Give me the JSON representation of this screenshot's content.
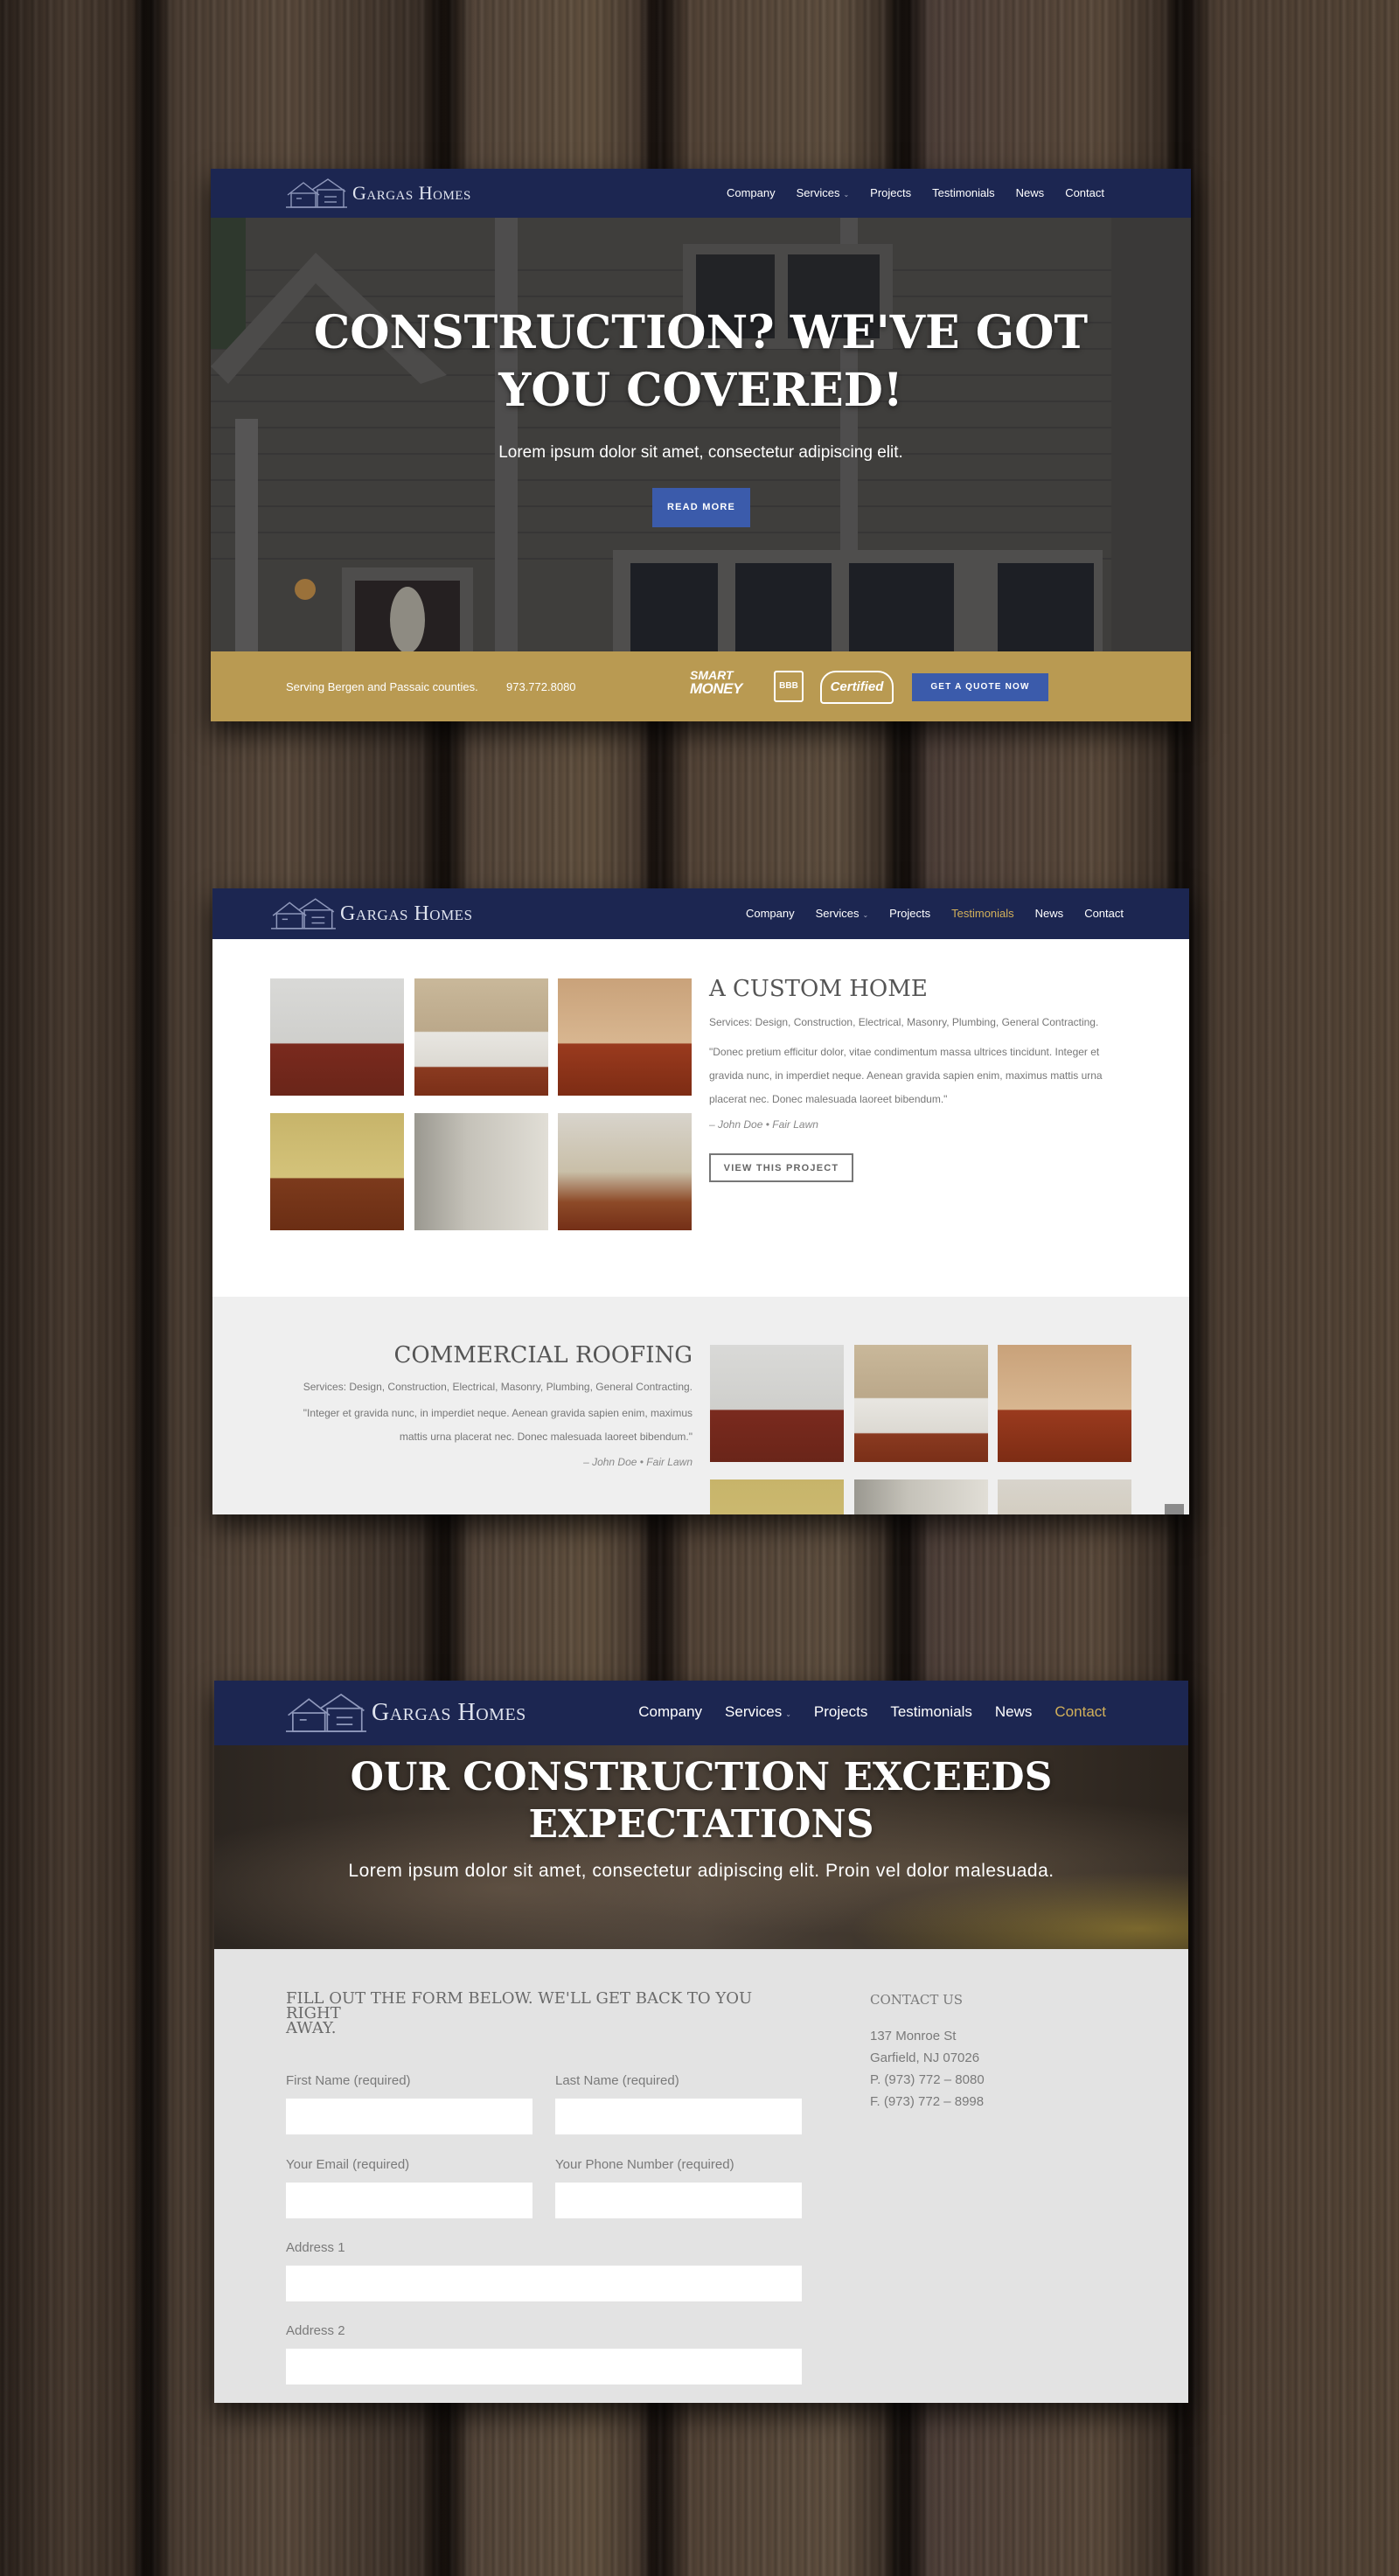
{
  "brand": {
    "name": "Gargas Homes"
  },
  "nav": {
    "company": "Company",
    "services": "Services",
    "projects": "Projects",
    "testimonials": "Testimonials",
    "news": "News",
    "contact": "Contact"
  },
  "screen1": {
    "hero_title_line1": "CONSTRUCTION? WE'VE GOT",
    "hero_title_line2": "YOU COVERED!",
    "hero_subtitle": "Lorem ipsum dolor sit amet, consectetur adipiscing elit.",
    "read_more": "READ MORE",
    "serving": "Serving Bergen and Passaic counties.",
    "phone": "973.772.8080",
    "badge_smart": "SMART",
    "badge_money": "MONEY",
    "badge_bbb": "BBB",
    "badge_certified": "Certified",
    "quote_button": "GET A QUOTE NOW"
  },
  "screen2": {
    "project1": {
      "title": "A CUSTOM HOME",
      "services": "Services: Design, Construction, Electrical, Masonry, Plumbing, General Contracting.",
      "quote_line1": "\"Donec pretium efficitur dolor, vitae condimentum massa ultrices tincidunt. Integer et",
      "quote_line2": "gravida nunc, in imperdiet neque. Aenean gravida sapien enim, maximus mattis urna",
      "quote_line3": "placerat nec. Donec malesuada laoreet bibendum.\"",
      "author": "– John Doe • Fair Lawn",
      "button": "VIEW THIS PROJECT"
    },
    "project2": {
      "title": "COMMERCIAL ROOFING",
      "services": "Services: Design, Construction, Electrical, Masonry, Plumbing, General Contracting.",
      "quote_line1": "\"Integer et gravida nunc, in imperdiet neque. Aenean gravida sapien enim, maximus",
      "quote_line2": "mattis urna placerat nec. Donec malesuada laoreet bibendum.\"",
      "author": "– John Doe • Fair Lawn"
    }
  },
  "screen3": {
    "hero_title_line1": "OUR CONSTRUCTION EXCEEDS",
    "hero_title_line2": "EXPECTATIONS",
    "hero_subtitle": "Lorem ipsum dolor sit amet, consectetur adipiscing elit. Proin vel dolor malesuada.",
    "form_heading_line1": "FILL OUT THE FORM BELOW. WE'LL GET BACK TO YOU RIGHT",
    "form_heading_line2": "AWAY.",
    "first_name": "First Name (required)",
    "last_name": "Last Name (required)",
    "email": "Your Email (required)",
    "phone": "Your Phone Number (required)",
    "address1": "Address 1",
    "address2": "Address 2",
    "contact_heading": "CONTACT US",
    "street": "137 Monroe St",
    "city": "Garfield, NJ 07026",
    "phone_line": "P. (973) 772 – 8080",
    "fax_line": "F. (973) 772 – 8998"
  },
  "colors": {
    "navy": "#1c2651",
    "gold": "#b99a52",
    "button_blue": "#3b5bab",
    "active_nav": "#d2b05a"
  }
}
